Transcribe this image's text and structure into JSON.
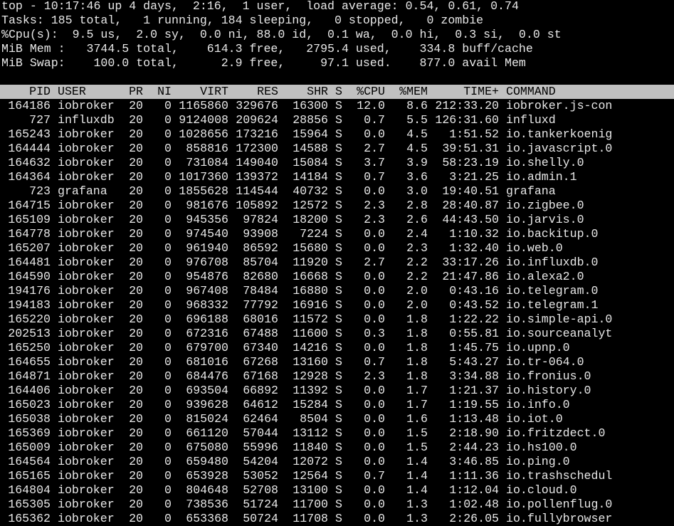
{
  "summary": {
    "uptime_line": "top - 10:17:46 up 4 days,  2:16,  1 user,  load average: 0.54, 0.61, 0.74",
    "tasks_line": "Tasks: 185 total,   1 running, 184 sleeping,   0 stopped,   0 zombie",
    "cpu_line": "%Cpu(s):  9.5 us,  2.0 sy,  0.0 ni, 88.0 id,  0.1 wa,  0.0 hi,  0.3 si,  0.0 st",
    "mem_line": "MiB Mem :   3744.5 total,    614.3 free,   2795.4 used,    334.8 buff/cache",
    "swap_line": "MiB Swap:    100.0 total,      2.9 free,     97.1 used.    877.0 avail Mem"
  },
  "columns": {
    "pid": "PID",
    "user": "USER",
    "pr": "PR",
    "ni": "NI",
    "virt": "VIRT",
    "res": "RES",
    "shr": "SHR",
    "s": "S",
    "cpu": "%CPU",
    "mem": "%MEM",
    "time": "TIME+",
    "command": "COMMAND"
  },
  "processes": [
    {
      "pid": "164186",
      "user": "iobroker",
      "pr": "20",
      "ni": "0",
      "virt": "1165860",
      "res": "329676",
      "shr": "16300",
      "s": "S",
      "cpu": "12.0",
      "mem": "8.6",
      "time": "212:33.20",
      "command": "iobroker.js-con"
    },
    {
      "pid": "727",
      "user": "influxdb",
      "pr": "20",
      "ni": "0",
      "virt": "9124008",
      "res": "209624",
      "shr": "28856",
      "s": "S",
      "cpu": "0.7",
      "mem": "5.5",
      "time": "126:31.60",
      "command": "influxd"
    },
    {
      "pid": "165243",
      "user": "iobroker",
      "pr": "20",
      "ni": "0",
      "virt": "1028656",
      "res": "173216",
      "shr": "15964",
      "s": "S",
      "cpu": "0.0",
      "mem": "4.5",
      "time": "1:51.52",
      "command": "io.tankerkoenig"
    },
    {
      "pid": "164444",
      "user": "iobroker",
      "pr": "20",
      "ni": "0",
      "virt": "858816",
      "res": "172300",
      "shr": "14588",
      "s": "S",
      "cpu": "2.7",
      "mem": "4.5",
      "time": "39:51.31",
      "command": "io.javascript.0"
    },
    {
      "pid": "164632",
      "user": "iobroker",
      "pr": "20",
      "ni": "0",
      "virt": "731084",
      "res": "149040",
      "shr": "15084",
      "s": "S",
      "cpu": "3.7",
      "mem": "3.9",
      "time": "58:23.19",
      "command": "io.shelly.0"
    },
    {
      "pid": "164364",
      "user": "iobroker",
      "pr": "20",
      "ni": "0",
      "virt": "1017360",
      "res": "139372",
      "shr": "14184",
      "s": "S",
      "cpu": "0.7",
      "mem": "3.6",
      "time": "3:21.25",
      "command": "io.admin.1"
    },
    {
      "pid": "723",
      "user": "grafana",
      "pr": "20",
      "ni": "0",
      "virt": "1855628",
      "res": "114544",
      "shr": "40732",
      "s": "S",
      "cpu": "0.0",
      "mem": "3.0",
      "time": "19:40.51",
      "command": "grafana"
    },
    {
      "pid": "164715",
      "user": "iobroker",
      "pr": "20",
      "ni": "0",
      "virt": "981676",
      "res": "105892",
      "shr": "12572",
      "s": "S",
      "cpu": "2.3",
      "mem": "2.8",
      "time": "28:40.87",
      "command": "io.zigbee.0"
    },
    {
      "pid": "165109",
      "user": "iobroker",
      "pr": "20",
      "ni": "0",
      "virt": "945356",
      "res": "97824",
      "shr": "18200",
      "s": "S",
      "cpu": "2.3",
      "mem": "2.6",
      "time": "44:43.50",
      "command": "io.jarvis.0"
    },
    {
      "pid": "164778",
      "user": "iobroker",
      "pr": "20",
      "ni": "0",
      "virt": "974540",
      "res": "93908",
      "shr": "7224",
      "s": "S",
      "cpu": "0.0",
      "mem": "2.4",
      "time": "1:10.32",
      "command": "io.backitup.0"
    },
    {
      "pid": "165207",
      "user": "iobroker",
      "pr": "20",
      "ni": "0",
      "virt": "961940",
      "res": "86592",
      "shr": "15680",
      "s": "S",
      "cpu": "0.0",
      "mem": "2.3",
      "time": "1:32.40",
      "command": "io.web.0"
    },
    {
      "pid": "164481",
      "user": "iobroker",
      "pr": "20",
      "ni": "0",
      "virt": "976708",
      "res": "85704",
      "shr": "11920",
      "s": "S",
      "cpu": "2.7",
      "mem": "2.2",
      "time": "33:17.26",
      "command": "io.influxdb.0"
    },
    {
      "pid": "164590",
      "user": "iobroker",
      "pr": "20",
      "ni": "0",
      "virt": "954876",
      "res": "82680",
      "shr": "16668",
      "s": "S",
      "cpu": "0.0",
      "mem": "2.2",
      "time": "21:47.86",
      "command": "io.alexa2.0"
    },
    {
      "pid": "194176",
      "user": "iobroker",
      "pr": "20",
      "ni": "0",
      "virt": "967408",
      "res": "78484",
      "shr": "16880",
      "s": "S",
      "cpu": "0.0",
      "mem": "2.0",
      "time": "0:43.16",
      "command": "io.telegram.0"
    },
    {
      "pid": "194183",
      "user": "iobroker",
      "pr": "20",
      "ni": "0",
      "virt": "968332",
      "res": "77792",
      "shr": "16916",
      "s": "S",
      "cpu": "0.0",
      "mem": "2.0",
      "time": "0:43.52",
      "command": "io.telegram.1"
    },
    {
      "pid": "165220",
      "user": "iobroker",
      "pr": "20",
      "ni": "0",
      "virt": "696188",
      "res": "68016",
      "shr": "11572",
      "s": "S",
      "cpu": "0.0",
      "mem": "1.8",
      "time": "1:22.22",
      "command": "io.simple-api.0"
    },
    {
      "pid": "202513",
      "user": "iobroker",
      "pr": "20",
      "ni": "0",
      "virt": "672316",
      "res": "67488",
      "shr": "11600",
      "s": "S",
      "cpu": "0.3",
      "mem": "1.8",
      "time": "0:55.81",
      "command": "io.sourceanalyt"
    },
    {
      "pid": "165250",
      "user": "iobroker",
      "pr": "20",
      "ni": "0",
      "virt": "679700",
      "res": "67340",
      "shr": "14216",
      "s": "S",
      "cpu": "0.0",
      "mem": "1.8",
      "time": "1:45.75",
      "command": "io.upnp.0"
    },
    {
      "pid": "164655",
      "user": "iobroker",
      "pr": "20",
      "ni": "0",
      "virt": "681016",
      "res": "67268",
      "shr": "13160",
      "s": "S",
      "cpu": "0.7",
      "mem": "1.8",
      "time": "5:43.27",
      "command": "io.tr-064.0"
    },
    {
      "pid": "164871",
      "user": "iobroker",
      "pr": "20",
      "ni": "0",
      "virt": "684476",
      "res": "67168",
      "shr": "12928",
      "s": "S",
      "cpu": "2.3",
      "mem": "1.8",
      "time": "3:34.88",
      "command": "io.fronius.0"
    },
    {
      "pid": "164406",
      "user": "iobroker",
      "pr": "20",
      "ni": "0",
      "virt": "693504",
      "res": "66892",
      "shr": "11392",
      "s": "S",
      "cpu": "0.0",
      "mem": "1.7",
      "time": "1:21.37",
      "command": "io.history.0"
    },
    {
      "pid": "165023",
      "user": "iobroker",
      "pr": "20",
      "ni": "0",
      "virt": "939628",
      "res": "64612",
      "shr": "15284",
      "s": "S",
      "cpu": "0.0",
      "mem": "1.7",
      "time": "1:19.55",
      "command": "io.info.0"
    },
    {
      "pid": "165038",
      "user": "iobroker",
      "pr": "20",
      "ni": "0",
      "virt": "815024",
      "res": "62464",
      "shr": "8504",
      "s": "S",
      "cpu": "0.0",
      "mem": "1.6",
      "time": "1:13.48",
      "command": "io.iot.0"
    },
    {
      "pid": "165369",
      "user": "iobroker",
      "pr": "20",
      "ni": "0",
      "virt": "661120",
      "res": "57044",
      "shr": "13112",
      "s": "S",
      "cpu": "0.0",
      "mem": "1.5",
      "time": "2:18.90",
      "command": "io.fritzdect.0"
    },
    {
      "pid": "165009",
      "user": "iobroker",
      "pr": "20",
      "ni": "0",
      "virt": "675080",
      "res": "55996",
      "shr": "11840",
      "s": "S",
      "cpu": "0.0",
      "mem": "1.5",
      "time": "2:44.23",
      "command": "io.hs100.0"
    },
    {
      "pid": "164564",
      "user": "iobroker",
      "pr": "20",
      "ni": "0",
      "virt": "659480",
      "res": "54204",
      "shr": "12072",
      "s": "S",
      "cpu": "0.0",
      "mem": "1.4",
      "time": "3:46.85",
      "command": "io.ping.0"
    },
    {
      "pid": "165165",
      "user": "iobroker",
      "pr": "20",
      "ni": "0",
      "virt": "653928",
      "res": "53052",
      "shr": "12564",
      "s": "S",
      "cpu": "0.7",
      "mem": "1.4",
      "time": "1:11.36",
      "command": "io.trashschedul"
    },
    {
      "pid": "164804",
      "user": "iobroker",
      "pr": "20",
      "ni": "0",
      "virt": "804648",
      "res": "52708",
      "shr": "13100",
      "s": "S",
      "cpu": "0.0",
      "mem": "1.4",
      "time": "1:12.04",
      "command": "io.cloud.0"
    },
    {
      "pid": "165305",
      "user": "iobroker",
      "pr": "20",
      "ni": "0",
      "virt": "738536",
      "res": "51724",
      "shr": "11700",
      "s": "S",
      "cpu": "0.0",
      "mem": "1.3",
      "time": "1:02.48",
      "command": "io.pollenflug.0"
    },
    {
      "pid": "165362",
      "user": "iobroker",
      "pr": "20",
      "ni": "0",
      "virt": "653368",
      "res": "50724",
      "shr": "11708",
      "s": "S",
      "cpu": "0.0",
      "mem": "1.3",
      "time": "2:26.05",
      "command": "io.fullybrowser"
    }
  ],
  "colors": {
    "background": "#000000",
    "foreground": "#e8e8e8",
    "header_bar": "#c0c0c0",
    "header_text": "#000000"
  }
}
